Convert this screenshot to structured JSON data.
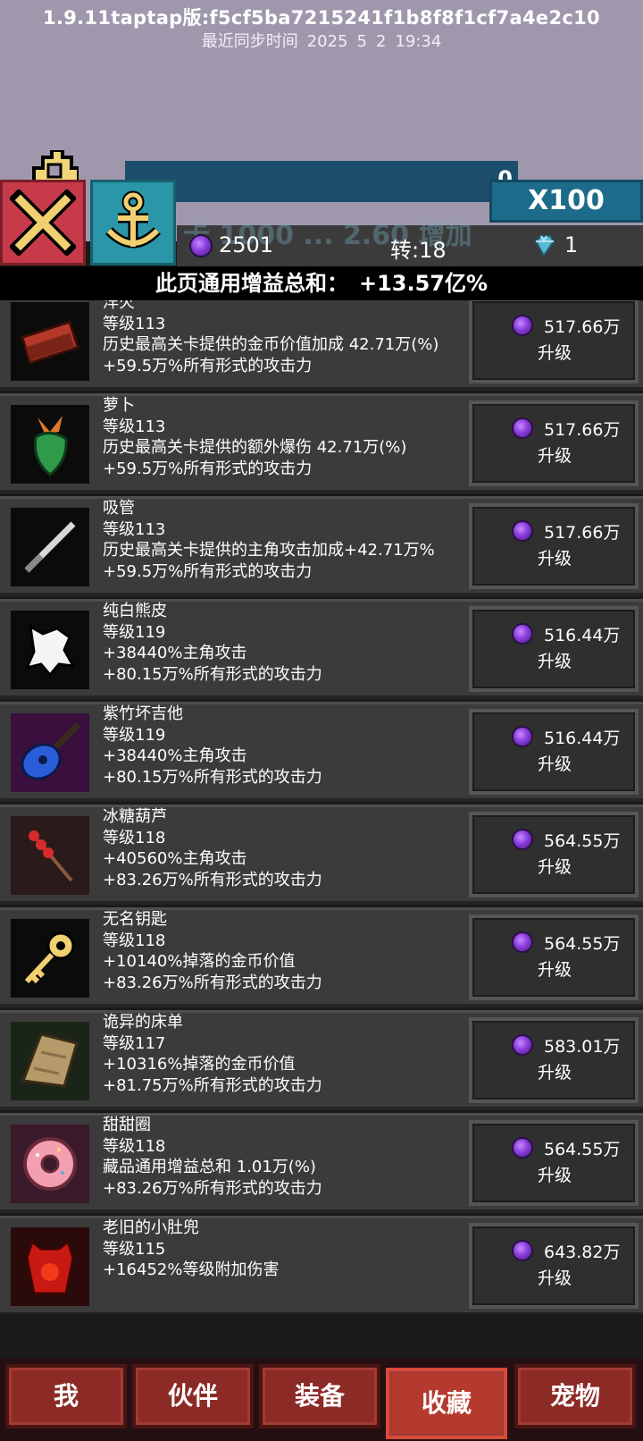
{
  "header": {
    "version": "1.9.11taptap版:f5cf5ba7215241f1b8f8f1cf7a4e2c10",
    "sync_label": "最近同步时间",
    "sync_year": "2025",
    "sync_month": "5",
    "sync_day": "2",
    "sync_time": "19:34"
  },
  "top": {
    "progress_value": "0",
    "multiplier": "X100",
    "obscured_text": "卡 1000 ... 2.60 增加"
  },
  "resources": {
    "gems": "2501",
    "turn": "转:18",
    "diamonds": "1"
  },
  "bonus": {
    "label": "此页通用增益总和：",
    "value": "+13.57亿%"
  },
  "items": [
    {
      "name": "洋火",
      "level": "等级113",
      "effect": "历史最高关卡提供的金币价值加成 42.71万(%)",
      "attack": "+59.5万%所有形式的攻击力",
      "cost": "517.66万",
      "upgrade": "升级",
      "icon": "matchbox-icon"
    },
    {
      "name": "萝卜",
      "level": "等级113",
      "effect": "历史最高关卡提供的额外爆伤 42.71万(%)",
      "attack": "+59.5万%所有形式的攻击力",
      "cost": "517.66万",
      "upgrade": "升级",
      "icon": "radish-icon"
    },
    {
      "name": "吸管",
      "level": "等级113",
      "effect": "历史最高关卡提供的主角攻击加成+42.71万%",
      "attack": "+59.5万%所有形式的攻击力",
      "cost": "517.66万",
      "upgrade": "升级",
      "icon": "straw-icon"
    },
    {
      "name": "纯白熊皮",
      "level": "等级119",
      "effect": "+38440%主角攻击",
      "attack": "+80.15万%所有形式的攻击力",
      "cost": "516.44万",
      "upgrade": "升级",
      "icon": "bear-pelt-icon"
    },
    {
      "name": "紫竹坏吉他",
      "level": "等级119",
      "effect": "+38440%主角攻击",
      "attack": "+80.15万%所有形式的攻击力",
      "cost": "516.44万",
      "upgrade": "升级",
      "icon": "guitar-icon"
    },
    {
      "name": "冰糖葫芦",
      "level": "等级118",
      "effect": "+40560%主角攻击",
      "attack": "+83.26万%所有形式的攻击力",
      "cost": "564.55万",
      "upgrade": "升级",
      "icon": "candied-haws-icon"
    },
    {
      "name": "无名钥匙",
      "level": "等级118",
      "effect": "+10140%掉落的金币价值",
      "attack": "+83.26万%所有形式的攻击力",
      "cost": "564.55万",
      "upgrade": "升级",
      "icon": "key-icon"
    },
    {
      "name": "诡异的床单",
      "level": "等级117",
      "effect": "+10316%掉落的金币价值",
      "attack": "+81.75万%所有形式的攻击力",
      "cost": "583.01万",
      "upgrade": "升级",
      "icon": "bedsheet-icon"
    },
    {
      "name": "甜甜圈",
      "level": "等级118",
      "effect": "藏品通用增益总和 1.01万(%)",
      "attack": "+83.26万%所有形式的攻击力",
      "cost": "564.55万",
      "upgrade": "升级",
      "icon": "donut-icon"
    },
    {
      "name": "老旧的小肚兜",
      "level": "等级115",
      "effect": "+16452%等级附加伤害",
      "attack": "",
      "cost": "643.82万",
      "upgrade": "升级",
      "icon": "bib-icon"
    }
  ],
  "nav": [
    {
      "label": "我"
    },
    {
      "label": "伙伴"
    },
    {
      "label": "装备"
    },
    {
      "label": "收藏",
      "active": true
    },
    {
      "label": "宠物"
    }
  ]
}
